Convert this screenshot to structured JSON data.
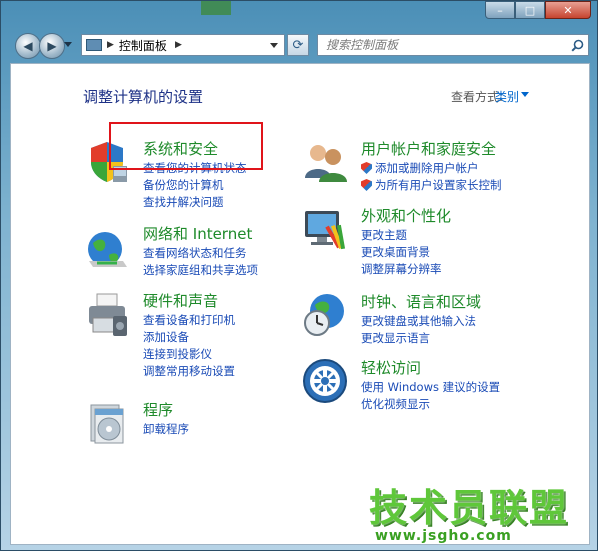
{
  "navigation": {
    "address": {
      "segment": "控制面板"
    },
    "search": {
      "placeholder": "搜索控制面板"
    }
  },
  "header": {
    "title": "调整计算机的设置",
    "view_by_label": "查看方式:",
    "view_by_value": "类别"
  },
  "categories": [
    {
      "title": "系统和安全",
      "icon": "shield-icon",
      "links": [
        "查看您的计算机状态",
        "备份您的计算机",
        "查找并解决问题"
      ]
    },
    {
      "title": "网络和 Internet",
      "icon": "globe-network-icon",
      "links": [
        "查看网络状态和任务",
        "选择家庭组和共享选项"
      ]
    },
    {
      "title": "硬件和声音",
      "icon": "printer-icon",
      "links": [
        "查看设备和打印机",
        "添加设备",
        "连接到投影仪",
        "调整常用移动设置"
      ]
    },
    {
      "title": "程序",
      "icon": "programs-icon",
      "links": [
        "卸载程序"
      ]
    },
    {
      "title": "用户帐户和家庭安全",
      "icon": "users-icon",
      "links": [
        "添加或删除用户帐户",
        "为所有用户设置家长控制"
      ]
    },
    {
      "title": "外观和个性化",
      "icon": "monitor-paint-icon",
      "links": [
        "更改主题",
        "更改桌面背景",
        "调整屏幕分辨率"
      ]
    },
    {
      "title": "时钟、语言和区域",
      "icon": "clock-globe-icon",
      "links": [
        "更改键盘或其他输入法",
        "更改显示语言"
      ]
    },
    {
      "title": "轻松访问",
      "icon": "accessibility-icon",
      "links": [
        "使用 Windows 建议的设置",
        "优化视频显示"
      ]
    }
  ],
  "watermark": {
    "brand": "技术员联盟",
    "url": "www.jsgho.com"
  },
  "colors": {
    "category_title": "#1e8a2a",
    "link": "#1a4bb6",
    "page_title": "#1e3287",
    "highlight_box": "#e0141a"
  }
}
